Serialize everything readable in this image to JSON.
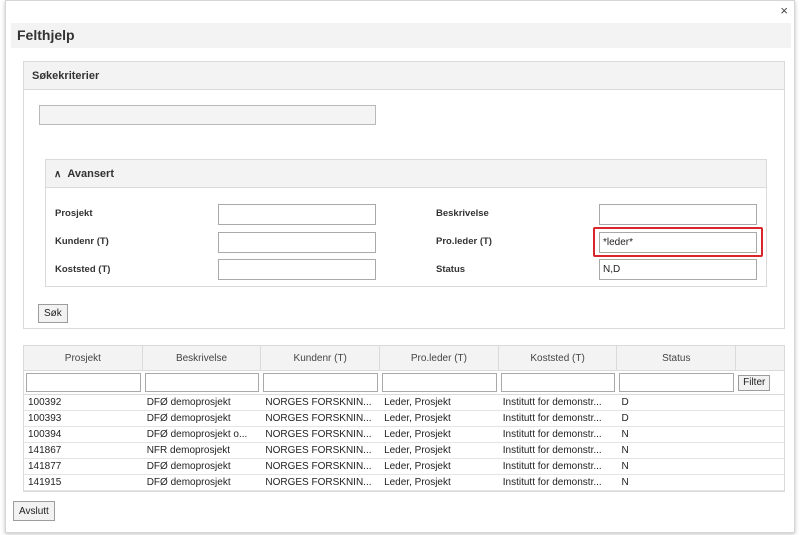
{
  "dialog": {
    "title": "Felthjelp",
    "close_symbol": "×"
  },
  "search": {
    "panel_title": "Søkekriterier",
    "quick_value": "",
    "advanced": {
      "header": "Avansert",
      "icon": "double-chevron-up-icon",
      "labels": {
        "prosjekt": "Prosjekt",
        "kundenr": "Kundenr (T)",
        "koststed": "Koststed (T)",
        "beskrivelse": "Beskrivelse",
        "proleder": "Pro.leder (T)",
        "status": "Status"
      },
      "values": {
        "prosjekt": "",
        "kundenr": "",
        "koststed": "",
        "beskrivelse": "",
        "proleder": "*leder*",
        "status": "N,D"
      }
    },
    "search_button": "Søk"
  },
  "grid": {
    "columns": [
      "Prosjekt",
      "Beskrivelse",
      "Kundenr (T)",
      "Pro.leder (T)",
      "Koststed (T)",
      "Status"
    ],
    "filter_button": "Filter",
    "rows": [
      [
        "100392",
        "DFØ demoprosjekt",
        "NORGES FORSKNIN...",
        "Leder, Prosjekt",
        "Institutt for demonstr...",
        "D"
      ],
      [
        "100393",
        "DFØ demoprosjekt",
        "NORGES FORSKNIN...",
        "Leder, Prosjekt",
        "Institutt for demonstr...",
        "D"
      ],
      [
        "100394",
        "DFØ demoprosjekt o...",
        "NORGES FORSKNIN...",
        "Leder, Prosjekt",
        "Institutt for demonstr...",
        "N"
      ],
      [
        "141867",
        "NFR demoprosjekt",
        "NORGES FORSKNIN...",
        "Leder, Prosjekt",
        "Institutt for demonstr...",
        "N"
      ],
      [
        "141877",
        "DFØ demoprosjekt",
        "NORGES FORSKNIN...",
        "Leder, Prosjekt",
        "Institutt for demonstr...",
        "N"
      ],
      [
        "141915",
        "DFØ demoprosjekt",
        "NORGES FORSKNIN...",
        "Leder, Prosjekt",
        "Institutt for demonstr...",
        "N"
      ]
    ]
  },
  "footer": {
    "close_button": "Avslutt"
  },
  "colors": {
    "highlight": "#d9262c",
    "header_bg": "#f3f3f3",
    "border": "#dadada"
  }
}
